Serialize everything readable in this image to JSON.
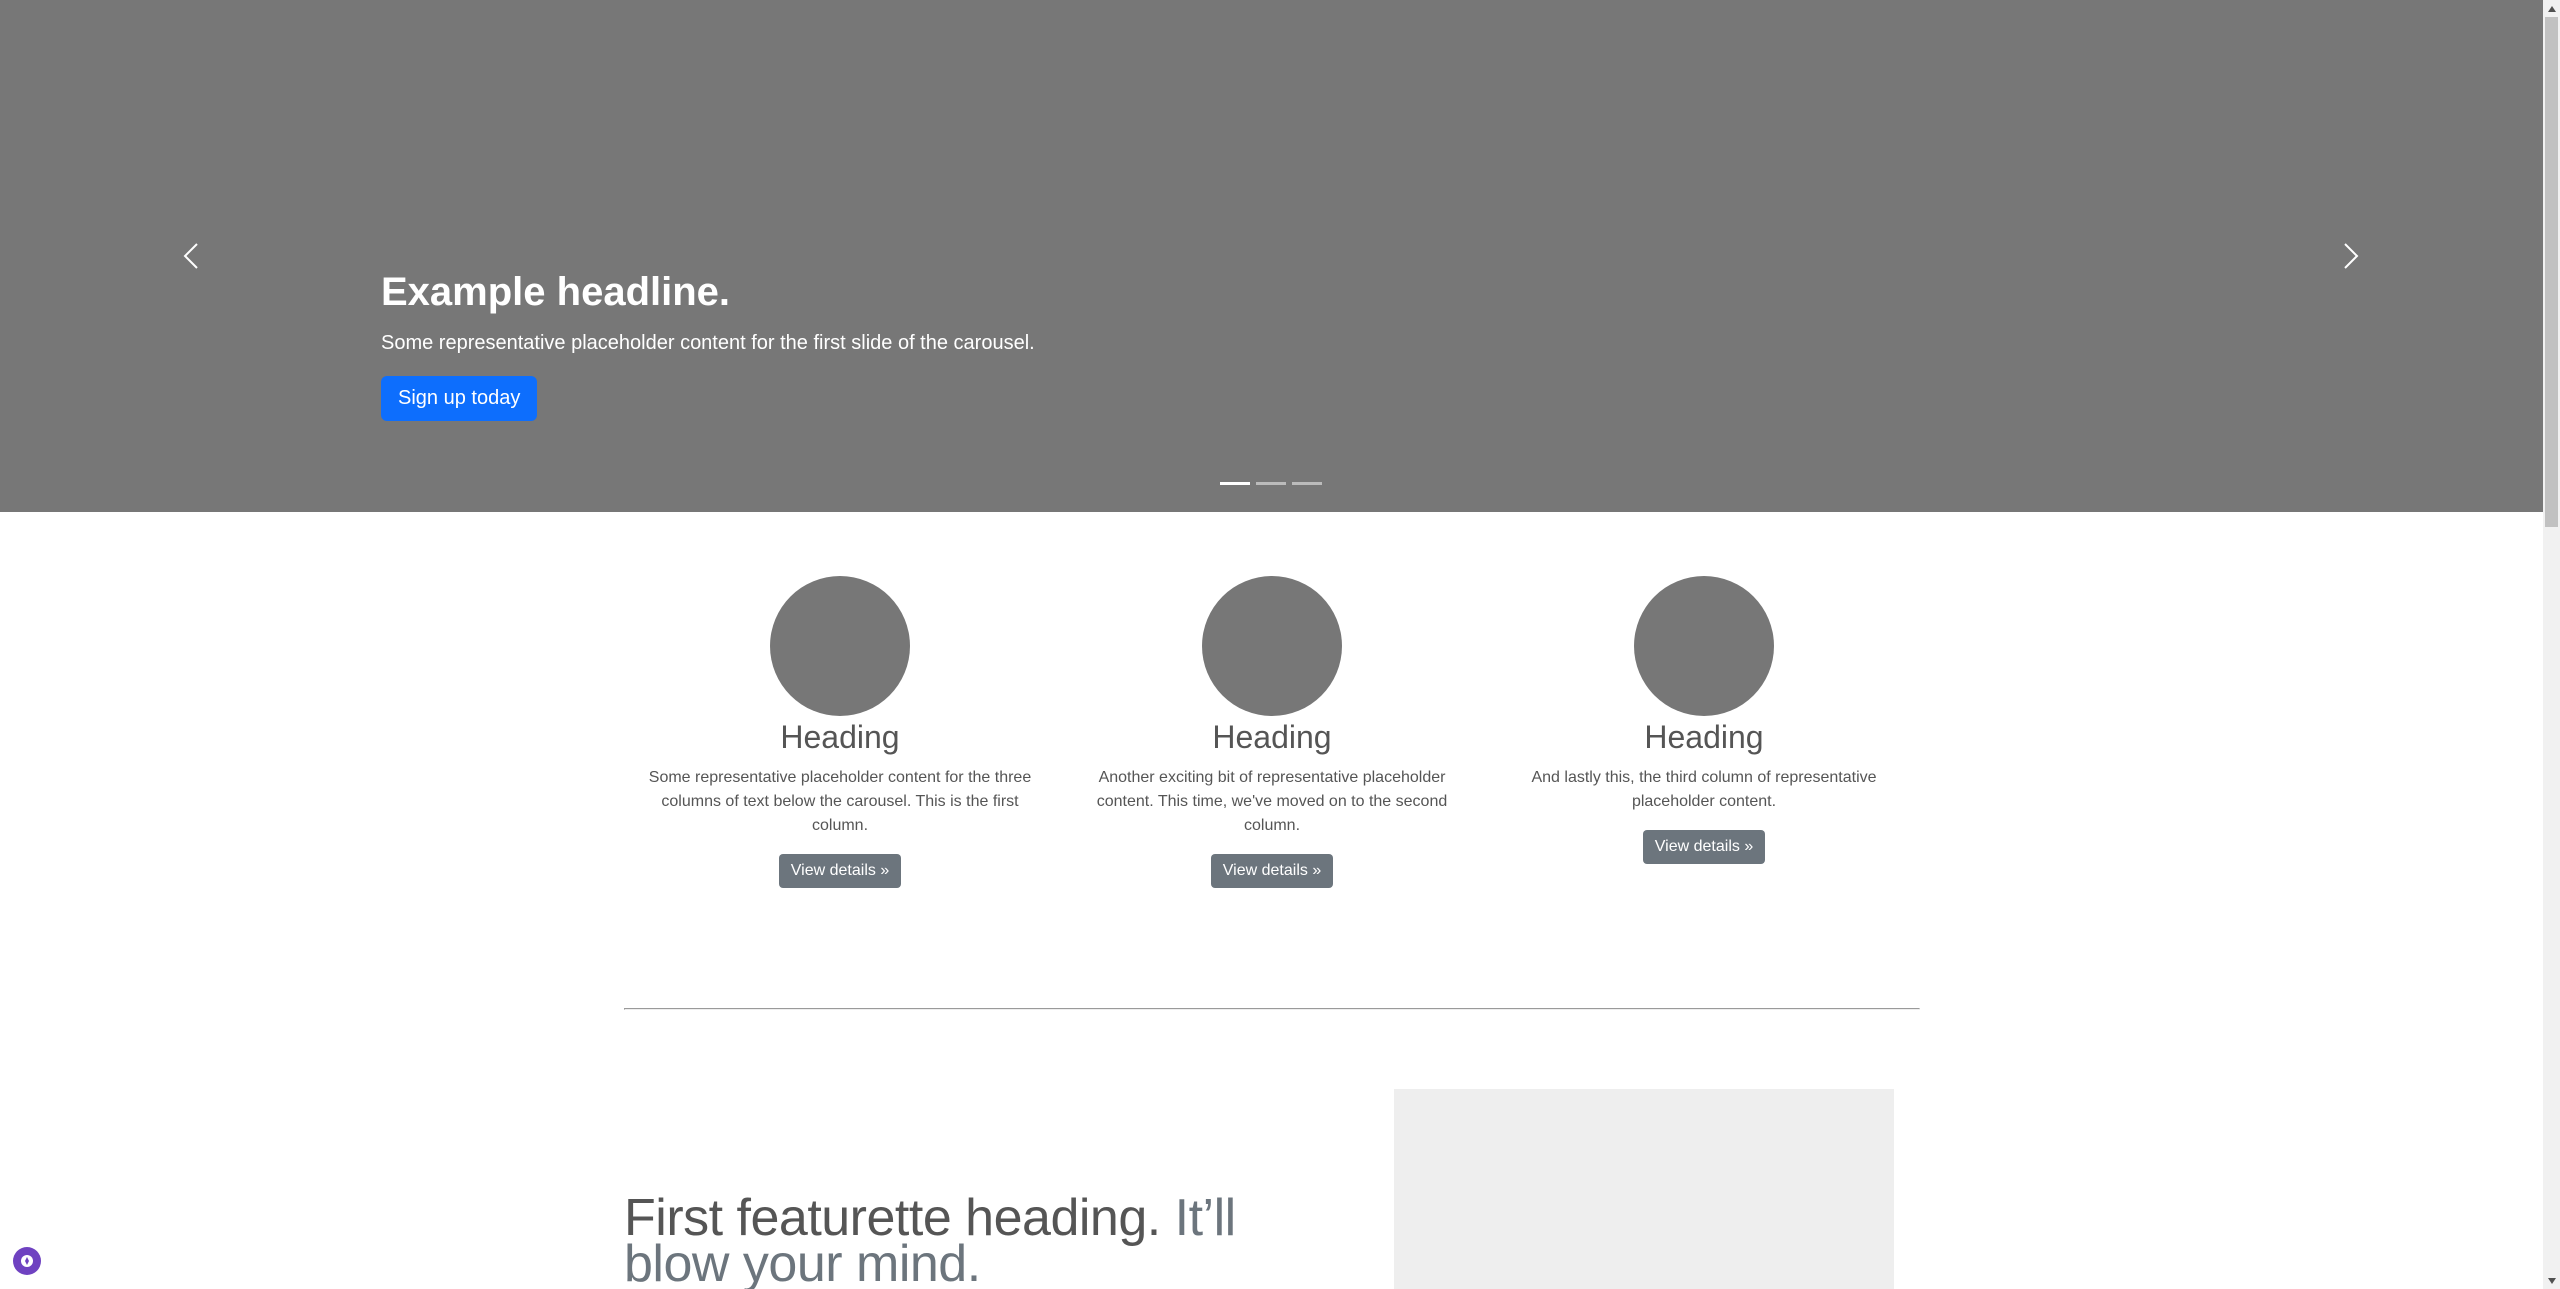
{
  "carousel": {
    "headline": "Example headline.",
    "text": "Some representative placeholder content for the first slide of the carousel.",
    "cta_label": "Sign up today",
    "prev_icon": "chevron-left-icon",
    "next_icon": "chevron-right-icon",
    "slide_count": 3,
    "active_slide": 1,
    "background_color": "#777777",
    "cta_color": "#0d6efd"
  },
  "marketing": {
    "columns": [
      {
        "heading": "Heading",
        "text": "Some representative placeholder content for the three columns of text below the carousel. This is the first column.",
        "button": "View details »"
      },
      {
        "heading": "Heading",
        "text": "Another exciting bit of representative placeholder content. This time, we've moved on to the second column.",
        "button": "View details »"
      },
      {
        "heading": "Heading",
        "text": "And lastly this, the third column of representative placeholder content.",
        "button": "View details »"
      }
    ]
  },
  "featurette": {
    "heading": "First featurette heading.",
    "heading_muted": "It’ll blow your mind."
  },
  "widget": {
    "icon": "compass-icon",
    "color": "#6f42c1"
  }
}
